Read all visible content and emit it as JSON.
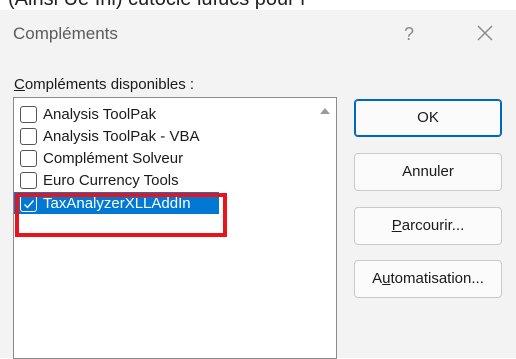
{
  "background_text": "(Ainsi Ue Ini) cutocle lufucs pour l",
  "dialog": {
    "title": "Compléments",
    "help_glyph": "?",
    "close_icon": "close-icon",
    "list_label_accel": "C",
    "list_label_rest": "ompléments disponibles :",
    "items": [
      {
        "label": "Analysis ToolPak",
        "checked": false,
        "selected": false
      },
      {
        "label": "Analysis ToolPak - VBA",
        "checked": false,
        "selected": false
      },
      {
        "label": "Complément Solveur",
        "checked": false,
        "selected": false
      },
      {
        "label": "Euro Currency Tools",
        "checked": false,
        "selected": false
      },
      {
        "label": "TaxAnalyzerXLLAddIn",
        "checked": true,
        "selected": true
      }
    ],
    "buttons": {
      "ok": "OK",
      "cancel": "Annuler",
      "browse_accel": "P",
      "browse_rest": "arcourir...",
      "automation_pre": "A",
      "automation_accel": "u",
      "automation_rest": "tomatisation..."
    }
  },
  "colors": {
    "selection": "#0078d4",
    "highlight": "#e8141c",
    "dialog_bg": "#f3f3f3"
  }
}
